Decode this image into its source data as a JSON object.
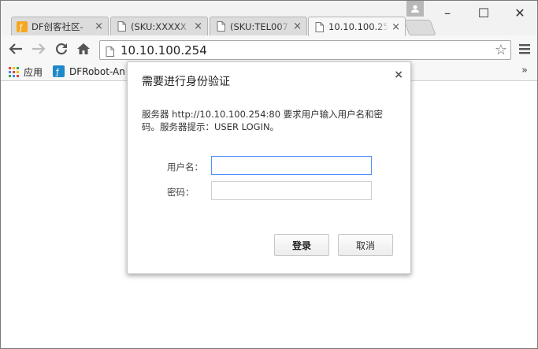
{
  "tabs": [
    {
      "title": "DF创客社区-",
      "favicon": "df-orange-icon",
      "active": false
    },
    {
      "title": "(SKU:XXXXX",
      "favicon": "page-icon",
      "active": false
    },
    {
      "title": "(SKU:TEL007",
      "favicon": "page-icon",
      "active": false
    },
    {
      "title": "10.10.100.254",
      "favicon": "page-icon",
      "active": true
    }
  ],
  "tab_close": "×",
  "window_controls": {
    "minimize": "–",
    "maximize": "☐",
    "close": "✕"
  },
  "toolbar": {
    "url": "10.10.100.254"
  },
  "bookmarks": {
    "apps_label": "应用",
    "dfrobot_label": "DFRobot-An",
    "more": "»"
  },
  "dialog": {
    "title": "需要进行身份验证",
    "message": "服务器 http://10.10.100.254:80 要求用户输入用户名和密码。服务器提示：USER LOGIN。",
    "username_label": "用户名：",
    "password_label": "密码：",
    "username_value": "",
    "password_value": "",
    "login_button": "登录",
    "cancel_button": "取消",
    "close": "×"
  },
  "colors": {
    "accent_focus": "#4d90fe",
    "df_orange": "#f5a623",
    "dfrobot_blue": "#1e88c8"
  }
}
